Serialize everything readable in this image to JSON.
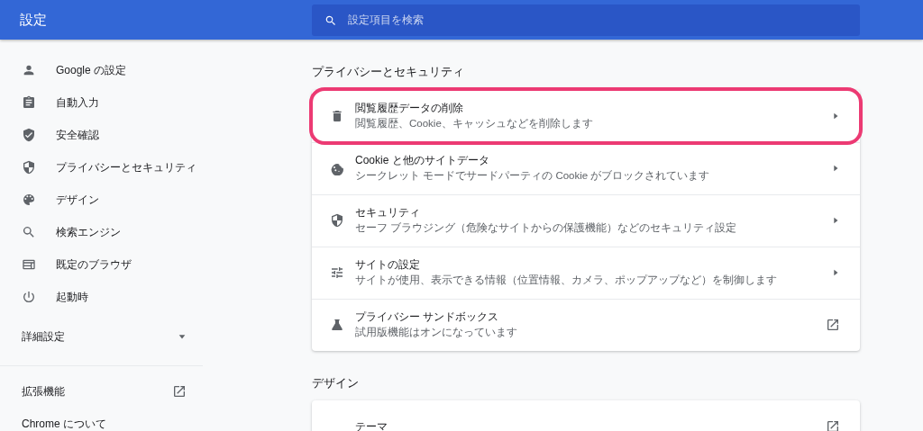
{
  "header": {
    "title": "設定",
    "search": {
      "placeholder": "設定項目を検索"
    }
  },
  "sidebar": {
    "items": [
      {
        "label": "Google の設定",
        "selected": false
      },
      {
        "label": "自動入力",
        "selected": false
      },
      {
        "label": "安全確認",
        "selected": false
      },
      {
        "label": "プライバシーとセキュリティ",
        "selected": false
      },
      {
        "label": "デザイン",
        "selected": false
      },
      {
        "label": "検索エンジン",
        "selected": false
      },
      {
        "label": "既定のブラウザ",
        "selected": false
      },
      {
        "label": "起動時",
        "selected": false
      }
    ],
    "advanced": {
      "label": "詳細設定",
      "expanded": false
    },
    "links": [
      {
        "label": "拡張機能",
        "kind": "external"
      },
      {
        "label": "Chrome について",
        "kind": "plain"
      }
    ]
  },
  "sections": [
    {
      "title": "プライバシーとセキュリティ",
      "rows": [
        {
          "title": "閲覧履歴データの削除",
          "subtitle": "閲覧履歴、Cookie、キャッシュなどを削除します",
          "kind": "submenu",
          "highlighted": true
        },
        {
          "title": "Cookie と他のサイトデータ",
          "subtitle": "シークレット モードでサードパーティの Cookie がブロックされています",
          "kind": "submenu",
          "highlighted": false
        },
        {
          "title": "セキュリティ",
          "subtitle": "セーフ ブラウジング（危険なサイトからの保護機能）などのセキュリティ設定",
          "kind": "submenu",
          "highlighted": false
        },
        {
          "title": "サイトの設定",
          "subtitle": "サイトが使用、表示できる情報（位置情報、カメラ、ポップアップなど）を制御します",
          "kind": "submenu",
          "highlighted": false
        },
        {
          "title": "プライバシー サンドボックス",
          "subtitle": "試用版機能はオンになっています",
          "kind": "external",
          "highlighted": false
        }
      ]
    },
    {
      "title": "デザイン",
      "rows": [
        {
          "title": "テーマ",
          "kind": "external",
          "highlighted": false
        }
      ]
    }
  ]
}
